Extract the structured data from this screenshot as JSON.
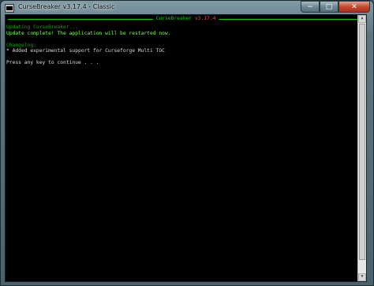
{
  "window": {
    "title": "CurseBreaker v3.17.4 - Classic",
    "minimize_glyph": "−",
    "maximize_glyph": "□",
    "close_glyph": "✕"
  },
  "console": {
    "header_app": "CurseBreaker",
    "header_version": "v3.17.4",
    "lines": [
      "Updating CurseBreaker...",
      "Update complete! The application will be restarted now.",
      "",
      "Changelog:",
      "* Added experimental support for Curseforge Multi TOC",
      "",
      "Press any key to continue . . ."
    ]
  },
  "colors": {
    "green": "#16c60c",
    "dark_green": "#13a10e",
    "red": "#e74856",
    "white": "#dcdcdc",
    "background": "#000000"
  },
  "icons": {
    "app": "console-window-icon",
    "scroll_up": "scroll-up-icon",
    "scroll_down": "scroll-down-icon"
  }
}
